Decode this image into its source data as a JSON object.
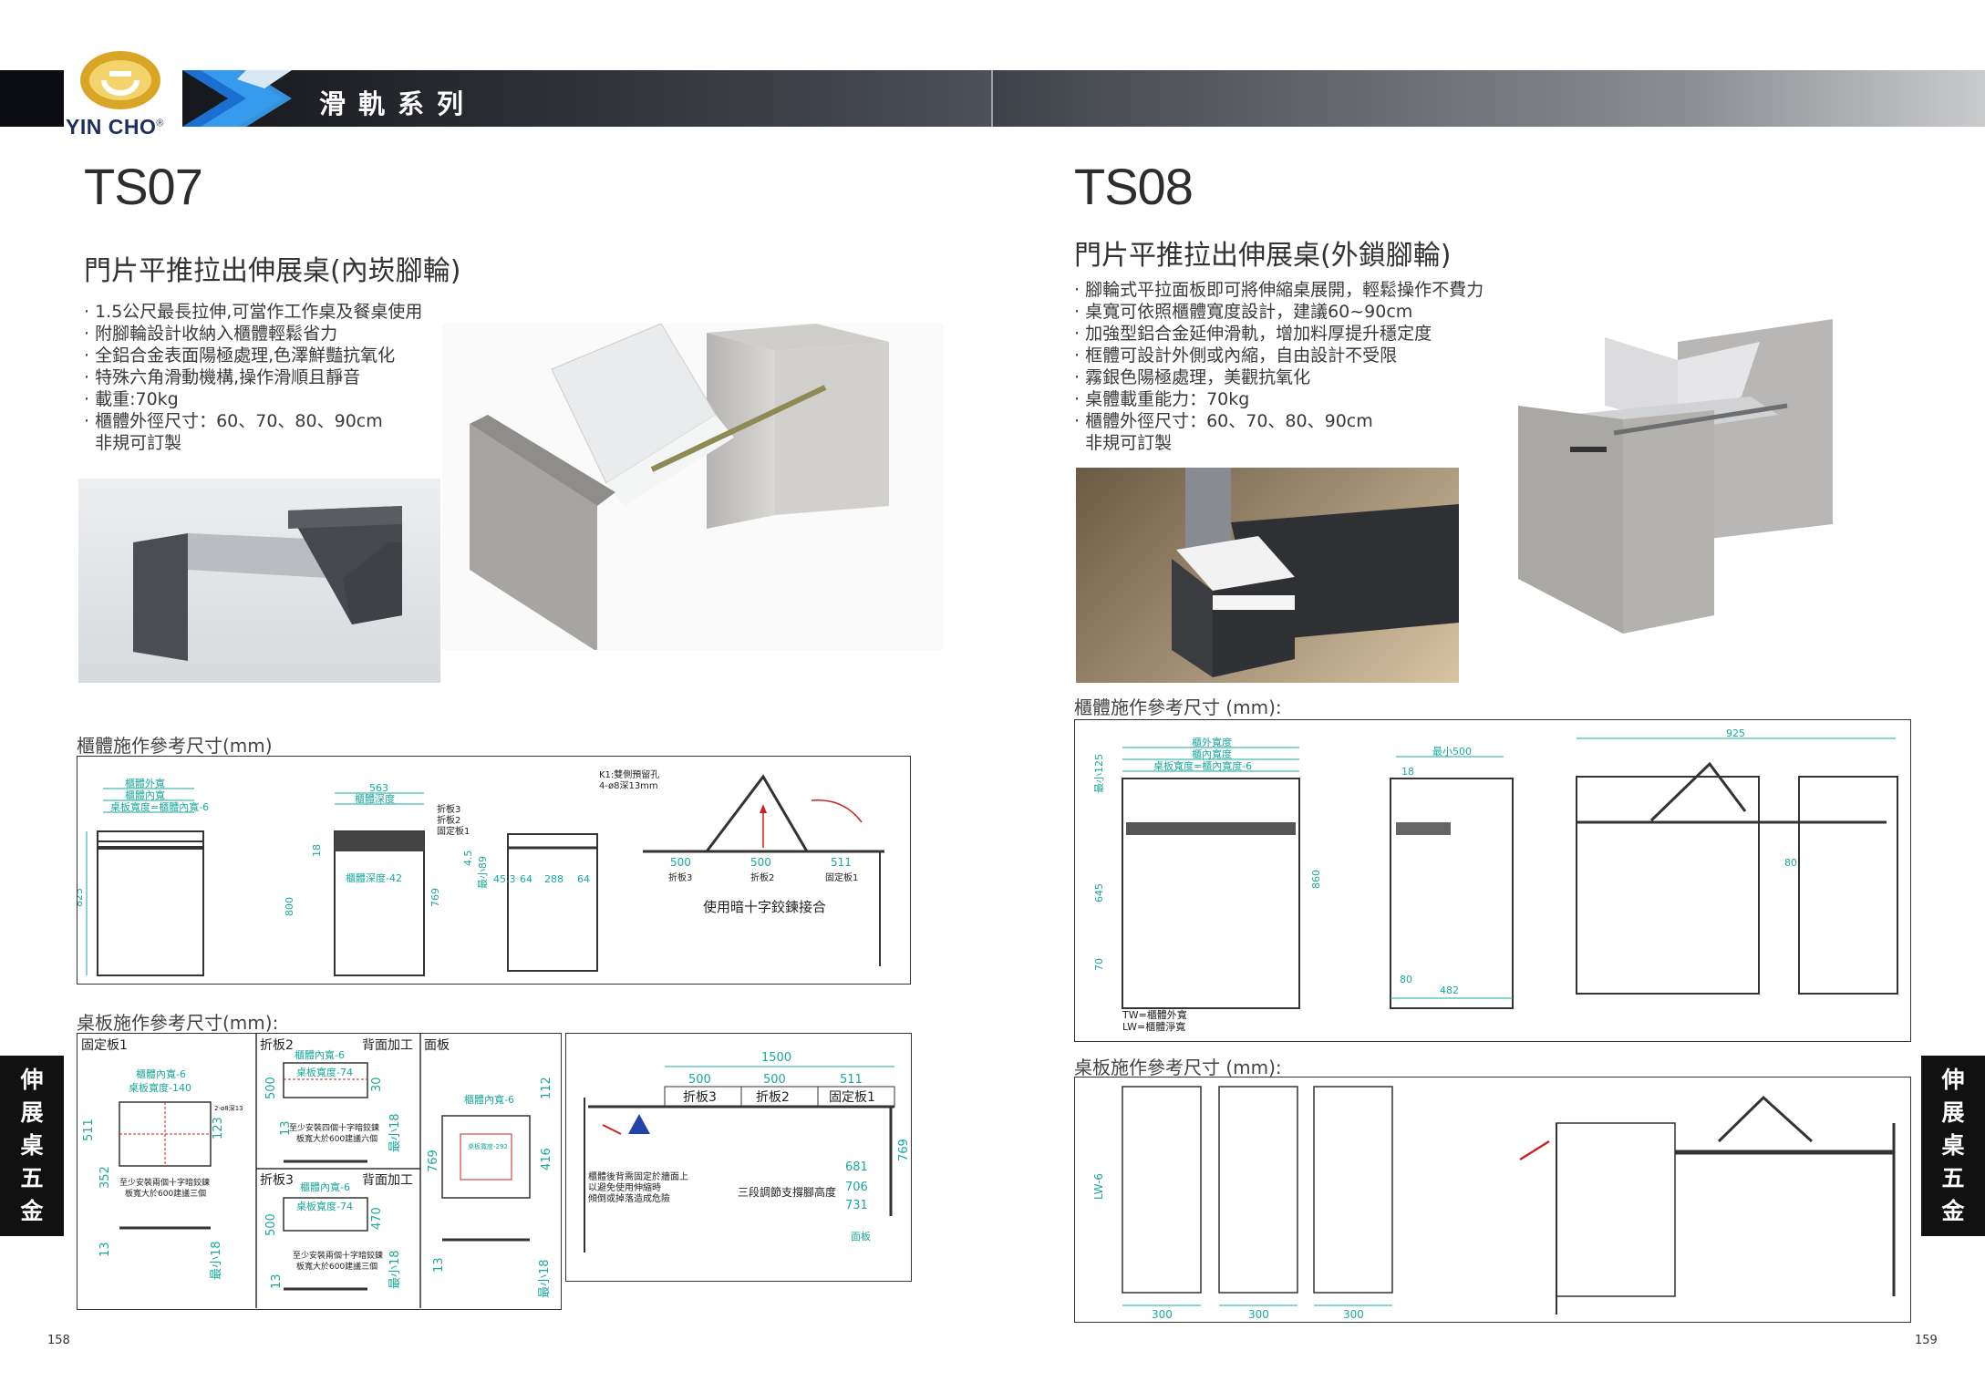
{
  "brand": {
    "name": "YIN CHO",
    "registered": "®"
  },
  "header": {
    "series_title": "滑軌系列"
  },
  "side_tab": {
    "chars": [
      "伸",
      "展",
      "桌",
      "五",
      "金"
    ]
  },
  "pages": {
    "left": "158",
    "right": "159"
  },
  "ts07": {
    "model": "TS07",
    "subtitle": "門片平推拉出伸展桌(內崁腳輪)",
    "bullets": [
      "· 1.5公尺最長拉伸,可當作工作桌及餐桌使用",
      "· 附腳輪設計收納入櫃體輕鬆省力",
      "· 全鋁合金表面陽極處理,色澤鮮豔抗氧化",
      "· 特殊六角滑動機構,操作滑順且靜音",
      "· 載重:70kg",
      "· 櫃體外徑尺寸：60、70、80、90cm",
      "  非規可訂製"
    ],
    "cabinet_label": "櫃體施作參考尺寸(mm)",
    "board_label": "桌板施作參考尺寸(mm):",
    "cab": {
      "outer_w": "櫃體外寬",
      "inner_w": "櫃體內寬",
      "board_w": "桌板寬度=櫃體內寬-6",
      "h825": "825",
      "d563": "563",
      "inner_depth": "櫃體深度",
      "depth_minus": "櫃體深度-42",
      "h18": "18",
      "h800": "800",
      "h769": "769",
      "fold_labels": [
        "折板3",
        "折板2",
        "固定板1"
      ],
      "k1": "K1:雙側預留孔",
      "k1b": "4-ø8深13mm",
      "h45": "4.5",
      "min89": "最小89",
      "n453": "45.3",
      "n64a": "64",
      "n288": "288",
      "n64b": "64",
      "s500a": "500",
      "s500b": "500",
      "s511": "511",
      "p3": "折板3",
      "p2": "折板2",
      "p1": "固定板1",
      "hinge": "使用暗十字鉸鍊接合"
    },
    "board": {
      "c1_title": "固定板1",
      "back": "背面加工",
      "c1_l1": "櫃體內寬-6",
      "c1_l2": "桌板寬度-140",
      "c1_d": "2-ø8深13",
      "c1_h511": "511",
      "c1_h123": "123",
      "c1_h352": "352",
      "c1_note1": "至少安裝兩個十字暗鉸鍊",
      "c1_note2": "板寬大於600建議三個",
      "c1_h13": "13",
      "c1_min18": "最小18",
      "c2_title": "折板2",
      "c2_back": "背面加工",
      "c2_l1": "櫃體內寬-6",
      "c2_l2": "桌板寬度-74",
      "c2_h500": "500",
      "c2_h30": "30",
      "c2_note1": "至少安裝四個十字暗鉸鍊",
      "c2_note2": "板寬大於600建議六個",
      "c2_h13": "13",
      "c2_min18": "最小18",
      "c3_title": "折板3",
      "c3_back": "背面加工",
      "c3_l1": "櫃體內寬-6",
      "c3_l2": "桌板寬度-74",
      "c3_h500": "500",
      "c3_h470": "470",
      "c3_note1": "至少安裝兩個十字暗鉸鍊",
      "c3_note2": "板寬大於600建議三個",
      "c3_h13": "13",
      "c3_min18": "最小18",
      "c4_title": "面板",
      "c4_l1": "櫃體內寬-6",
      "c4_l2": "桌板寬度-292",
      "c4_h112": "112",
      "c4_h769": "769",
      "c4_h416": "416",
      "c4_h13": "13",
      "c4_min18": "最小18",
      "total": "1500",
      "t500a": "500",
      "t500b": "500",
      "t511": "511",
      "tp3": "折板3",
      "tp2": "折板2",
      "tp1": "固定板1",
      "warn1": "櫃體後背需固定於牆面上",
      "warn2": "以避免使用伸縮時",
      "warn3": "傾倒或掉落造成危險",
      "support": "三段調節支撐腳高度",
      "h681": "681",
      "h706": "706",
      "h731": "731",
      "h769": "769",
      "panel": "面板"
    }
  },
  "ts08": {
    "model": "TS08",
    "subtitle": "門片平推拉出伸展桌(外鎖腳輪)",
    "bullets": [
      "· 腳輪式平拉面板即可將伸縮桌展開，輕鬆操作不費力",
      "· 桌寬可依照櫃體寬度設計，建議60~90cm",
      "· 加強型鋁合金延伸滑軌，增加料厚提升穩定度",
      "· 框體可設計外側或內縮，自由設計不受限",
      "· 霧銀色陽極處理，美觀抗氧化",
      "· 桌體載重能力：70kg",
      "· 櫃體外徑尺寸：60、70、80、90cm",
      "  非規可訂製"
    ],
    "cabinet_label": "櫃體施作參考尺寸 (mm):",
    "board_label": "桌板施作參考尺寸 (mm):",
    "cab": {
      "outer_w": "櫃外寬度",
      "inner_w": "櫃內寬度",
      "board_w": "桌板寬度=櫃內寬度-6",
      "min125": "最小125",
      "h645": "645",
      "h70": "70",
      "h860": "860",
      "min500": "最小500",
      "n18": "18",
      "n80": "80",
      "n482": "482",
      "n925": "925",
      "n80b": "80",
      "tw": "TW=櫃體外寬",
      "lw": "LW=櫃體淨寬"
    },
    "board": {
      "lw6": "LW-6",
      "w1": "300",
      "w2": "300",
      "w3": "300"
    }
  }
}
